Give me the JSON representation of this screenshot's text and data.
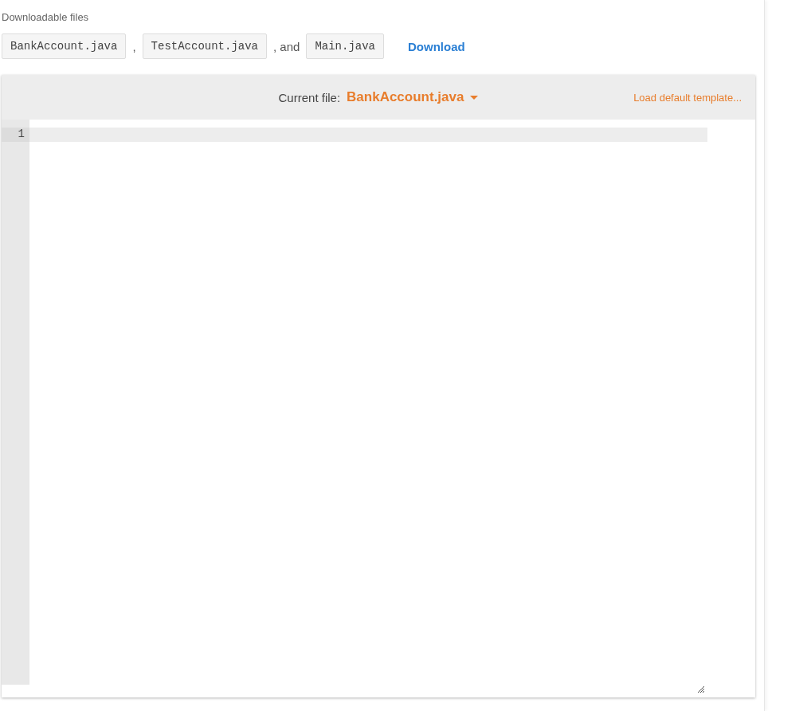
{
  "downloads": {
    "label": "Downloadable files",
    "items": [
      {
        "kind": "file",
        "text": "BankAccount.java"
      },
      {
        "kind": "text",
        "text": ","
      },
      {
        "kind": "file",
        "text": "TestAccount.java"
      },
      {
        "kind": "text",
        "text": ", and"
      },
      {
        "kind": "file",
        "text": "Main.java"
      }
    ],
    "download_link": "Download"
  },
  "editor": {
    "current_file_label": "Current file:",
    "current_file": "BankAccount.java",
    "load_template": "Load default template...",
    "lines": [
      {
        "number": "1",
        "active": true
      }
    ]
  }
}
